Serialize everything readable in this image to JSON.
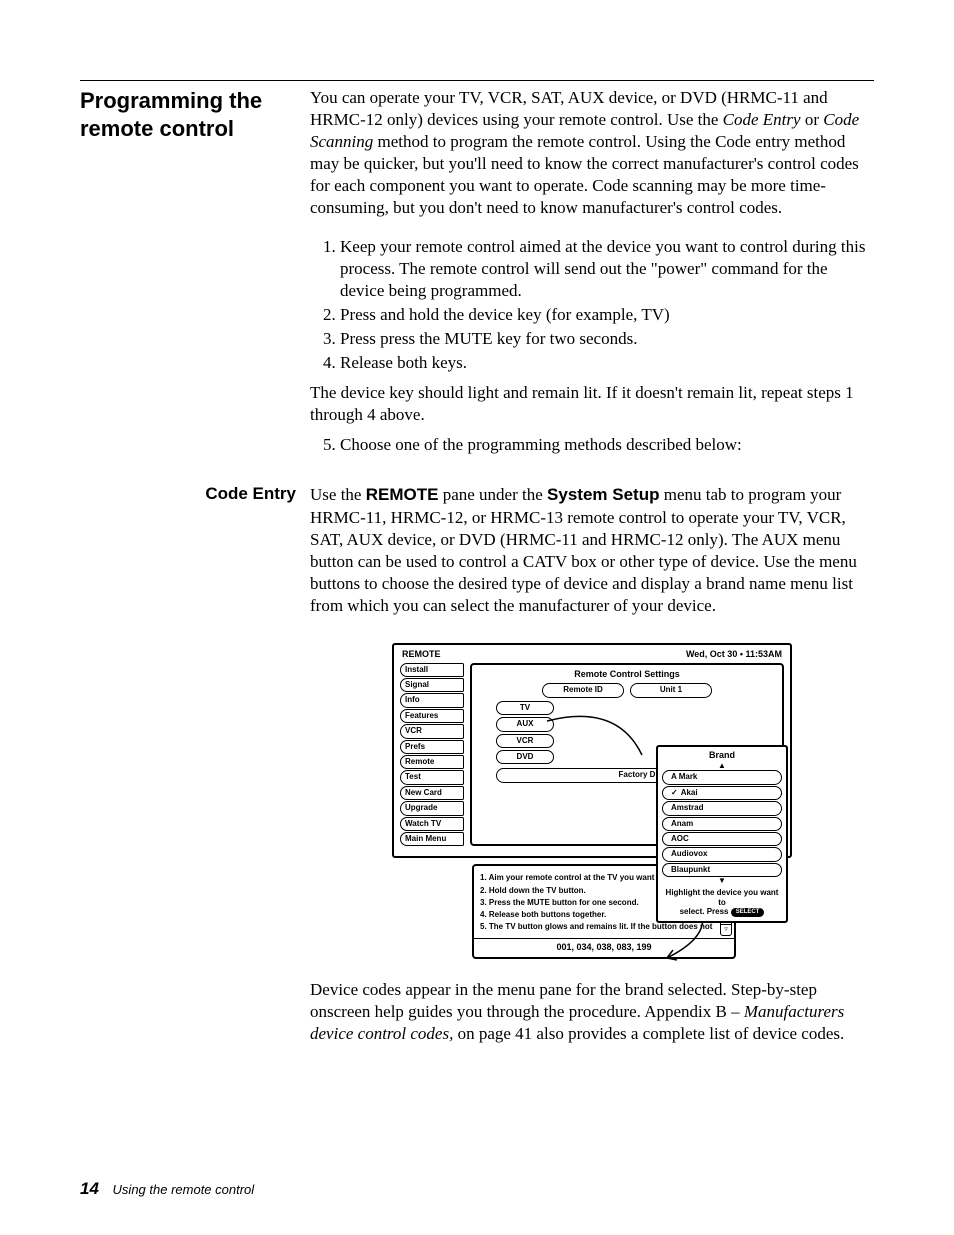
{
  "section_title": "Programming the remote control",
  "intro_pre": "You can operate your TV, VCR, SAT, AUX device, or DVD (HRMC-11 and HRMC-12 only) devices using your remote control. Use the ",
  "intro_em1": "Code Entry",
  "intro_mid1": " or ",
  "intro_em2": "Code Scanning",
  "intro_post": " method to program the remote control. Using the Code entry method may be quicker, but you'll need to know the correct manufacturer's control codes for each component you want to operate. Code scanning may be more time-consuming, but you don't need to know manufacturer's control codes.",
  "steps14": [
    "Keep your remote control aimed at the device you want to control during this process. The remote control will send out the \"power\" command for the device being programmed.",
    "Press and hold the device key (for example, TV)",
    "Press press the MUTE key for two seconds.",
    "Release both keys."
  ],
  "after_steps": "The device key should light and remain lit. If it doesn't remain lit, repeat steps 1 through 4 above.",
  "step5": "Choose one of the programming methods described below:",
  "code_entry_head": "Code Entry",
  "code_entry_pre": "Use the ",
  "code_entry_b1": "REMOTE",
  "code_entry_mid1": " pane under the ",
  "code_entry_b2": "System Setup",
  "code_entry_post": " menu tab to program your HRMC-11, HRMC-12, or HRMC-13 remote control to operate your TV, VCR, SAT, AUX device, or DVD (HRMC-11 and HRMC-12 only). The AUX menu button can be used to control a CATV box or other type of device. Use the menu buttons to choose the desired type of device and display a brand name menu list from which you can select the manufacturer of your device.",
  "outro_pre": "Device codes appear in the menu pane for the brand selected. Step-by-step onscreen help guides you through the procedure. Appendix B – ",
  "outro_em": "Manufacturers device control codes,",
  "outro_post": " on page 41 also provides a complete list of device codes.",
  "footer_page": "14",
  "footer_text": "Using the remote control",
  "diagram": {
    "header_left": "REMOTE",
    "header_right": "Wed, Oct 30 • 11:53AM",
    "side_tabs": [
      "Install",
      "Signal",
      "Info",
      "Features",
      "VCR",
      "Prefs",
      "Remote",
      "Test",
      "New Card",
      "Upgrade",
      "Watch TV",
      "Main Menu"
    ],
    "pane_title": "Remote Control Settings",
    "remote_id_label": "Remote ID",
    "remote_id_value": "Unit 1",
    "device_buttons": [
      "TV",
      "AUX",
      "VCR",
      "DVD"
    ],
    "factory_btn": "Factory D",
    "brand_title": "Brand",
    "brand_items": [
      "A Mark",
      "Akai",
      "Amstrad",
      "Anam",
      "AOC",
      "Audiovox",
      "Blaupunkt"
    ],
    "brand_checked_index": 1,
    "brand_help_line1": "Highlight the device you want to",
    "brand_help_line2": "select. Press ",
    "brand_help_select": "SELECT",
    "instr_steps": [
      "1. Aim your remote control at the TV you want to use.",
      "2. Hold down the TV button.",
      "3. Press the MUTE button for one second.",
      "4. Release both buttons together.",
      "5. The TV button glows and remains lit. If the button does not"
    ],
    "codes": "001, 034, 038, 083, 199"
  }
}
